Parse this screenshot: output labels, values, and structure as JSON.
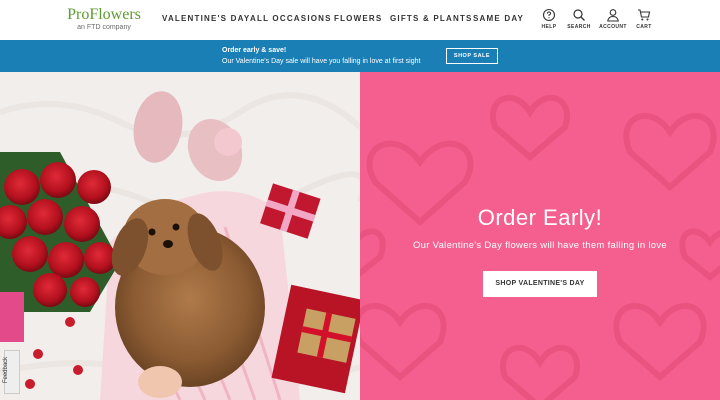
{
  "header": {
    "logo": {
      "brand": "ProFlowers",
      "tagline": "an FTD company"
    },
    "nav": [
      "VALENTINE'S DAY",
      "ALL OCCASIONS",
      "FLOWERS",
      "GIFTS & PLANTS",
      "SAME DAY"
    ],
    "utility": {
      "help": "HELP",
      "search": "SEARCH",
      "account": "ACCOUNT",
      "cart": "CART"
    }
  },
  "promo": {
    "title": "Order early & save!",
    "text": "Our Valentine's Day sale will have you falling in love at first sight",
    "button": "SHOP SALE"
  },
  "hero": {
    "title": "Order Early!",
    "subtitle": "Our Valentine's Day flowers will have them falling in love",
    "button": "SHOP VALENTINE'S DAY"
  },
  "feedback": {
    "label": "Feedback"
  },
  "colors": {
    "promo_bg": "#1a7fb5",
    "hero_panel": "#f45f8f",
    "logo_green": "#5c9b2f"
  }
}
